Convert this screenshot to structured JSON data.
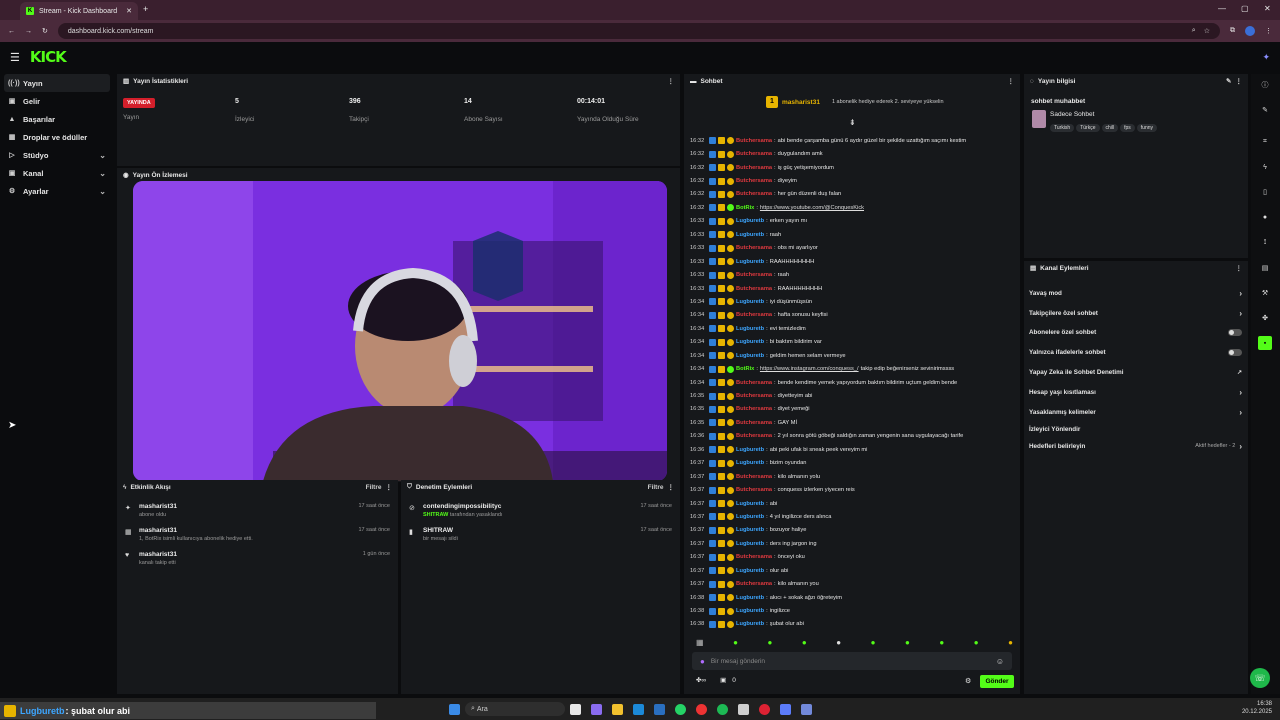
{
  "browser": {
    "tab_title": "Stream - Kick Dashboard",
    "url": "dashboard.kick.com/stream"
  },
  "app": {
    "logo": "KICK"
  },
  "sidebar": {
    "items": [
      {
        "label": "Yayın",
        "icon": "broadcast-icon",
        "active": true,
        "chevron": false
      },
      {
        "label": "Gelir",
        "icon": "wallet-icon",
        "active": false,
        "chevron": false
      },
      {
        "label": "Başarılar",
        "icon": "trophy-icon",
        "active": false,
        "chevron": false
      },
      {
        "label": "Droplar ve ödüller",
        "icon": "gift-icon",
        "active": false,
        "chevron": false
      },
      {
        "label": "Stüdyo",
        "icon": "studio-icon",
        "active": false,
        "chevron": true
      },
      {
        "label": "Kanal",
        "icon": "channel-icon",
        "active": false,
        "chevron": true
      },
      {
        "label": "Ayarlar",
        "icon": "gear-icon",
        "active": false,
        "chevron": true
      }
    ]
  },
  "stats": {
    "title": "Yayın İstatistikleri",
    "live_badge": "YAYINDA",
    "status_label": "Yayın",
    "items": [
      {
        "value": "5",
        "label": "İzleyici"
      },
      {
        "value": "396",
        "label": "Takipçi"
      },
      {
        "value": "14",
        "label": "Abone Sayısı"
      },
      {
        "value": "00:14:01",
        "label": "Yayında Olduğu Süre"
      }
    ]
  },
  "preview": {
    "title": "Yayın Ön İzlemesi"
  },
  "activity": {
    "title": "Etkinlik Akışı",
    "filter": "Filtre",
    "items": [
      {
        "icon": "star-icon",
        "name": "masharist31",
        "sub": "abone oldu",
        "time": "17 saat önce"
      },
      {
        "icon": "gift-icon",
        "name": "masharist31",
        "sub": "1, BotRix isimli kullanıcıya abonelik hediye etti.",
        "time": "17 saat önce"
      },
      {
        "icon": "heart-icon",
        "name": "masharist31",
        "sub": "kanalı takip etti",
        "time": "1 gün önce"
      }
    ]
  },
  "moderation": {
    "title": "Denetim Eylemleri",
    "filter": "Filtre",
    "items": [
      {
        "icon": "ban-icon",
        "name": "contendingimpossibilityc",
        "sub_user": "SHITRAW",
        "sub": "tarafından yasaklandı",
        "time": "17 saat önce"
      },
      {
        "icon": "trash-icon",
        "name": "SHITRAW",
        "sub_user": "",
        "sub": "bir mesajı sildi",
        "time": "17 saat önce"
      }
    ]
  },
  "chat": {
    "title": "Sohbet",
    "pinned_user": "masharist31",
    "pinned_count": "1",
    "hype": "1 abonelik hediye ederek 2. seviyeye yükselin",
    "input_placeholder": "Bir mesaj gönderin",
    "send": "Gönder",
    "viewer_count": "0",
    "colors": {
      "red": "#e0393f",
      "blue": "#3da6ff",
      "green": "#53fc18"
    },
    "messages": [
      {
        "t": "16:32",
        "u": "Butchersama",
        "c": "red",
        "m": "abi bende çarşamba günü 6 aydır güzel bir şekilde uzattığım saçımı kestim"
      },
      {
        "t": "16:32",
        "u": "Butchersama",
        "c": "red",
        "m": "duygulandım amk"
      },
      {
        "t": "16:32",
        "u": "Butchersama",
        "c": "red",
        "m": "iş güç yetişemiyordum"
      },
      {
        "t": "16:32",
        "u": "Butchersama",
        "c": "red",
        "m": "diyeyim"
      },
      {
        "t": "16:32",
        "u": "Butchersama",
        "c": "red",
        "m": "her gün düzenli duş falan"
      },
      {
        "t": "16:32",
        "u": "BotRix",
        "c": "green",
        "m": "https://www.youtube.com/@ConquesKick",
        "link": true
      },
      {
        "t": "16:33",
        "u": "Lugburetb",
        "c": "blue",
        "m": "erken yayın mı"
      },
      {
        "t": "16:33",
        "u": "Lugburetb",
        "c": "blue",
        "m": "raah"
      },
      {
        "t": "16:33",
        "u": "Butchersama",
        "c": "red",
        "m": "obs mi ayarlıyor"
      },
      {
        "t": "16:33",
        "u": "Lugburetb",
        "c": "blue",
        "m": "RAAHHHHHHHH"
      },
      {
        "t": "16:33",
        "u": "Butchersama",
        "c": "red",
        "m": "raah"
      },
      {
        "t": "16:33",
        "u": "Butchersama",
        "c": "red",
        "m": "RAAHHHHHHHH"
      },
      {
        "t": "16:34",
        "u": "Lugburetb",
        "c": "blue",
        "m": "iyi düşünmüşsün"
      },
      {
        "t": "16:34",
        "u": "Butchersama",
        "c": "red",
        "m": "hafta sonusu keyfisi"
      },
      {
        "t": "16:34",
        "u": "Lugburetb",
        "c": "blue",
        "m": "evi temizledim"
      },
      {
        "t": "16:34",
        "u": "Lugburetb",
        "c": "blue",
        "m": "bi baktım bildirim var"
      },
      {
        "t": "16:34",
        "u": "Lugburetb",
        "c": "blue",
        "m": "geldim hemen selam vermeye"
      },
      {
        "t": "16:34",
        "u": "BotRix",
        "c": "green",
        "m": "https://www.instagram.com/conquess_/",
        "link": true,
        "extra": " takip edip beğenirseniz sevinirimssss"
      },
      {
        "t": "16:34",
        "u": "Butchersama",
        "c": "red",
        "m": "bende kendime yemek yapıyordum baktım bildirim uçtum geldim bende"
      },
      {
        "t": "16:35",
        "u": "Butchersama",
        "c": "red",
        "m": "diyetteyim abi"
      },
      {
        "t": "16:35",
        "u": "Butchersama",
        "c": "red",
        "m": "diyet yemeği"
      },
      {
        "t": "16:35",
        "u": "Butchersama",
        "c": "red",
        "m": "GAY Mİ"
      },
      {
        "t": "16:36",
        "u": "Butchersama",
        "c": "red",
        "m": "2 yıl sonra götü göbeği saldığın zaman yengenin sana uygulayacağı tarife"
      },
      {
        "t": "16:36",
        "u": "Lugburetb",
        "c": "blue",
        "m": "abi peki ufak bi sneak peek vereyim mi"
      },
      {
        "t": "16:37",
        "u": "Lugburetb",
        "c": "blue",
        "m": "bizim oyundan"
      },
      {
        "t": "16:37",
        "u": "Butchersama",
        "c": "red",
        "m": "kilo almanın yolu"
      },
      {
        "t": "16:37",
        "u": "Butchersama",
        "c": "red",
        "m": "conquess izlerken yiyecen reis"
      },
      {
        "t": "16:37",
        "u": "Lugburetb",
        "c": "blue",
        "m": "abi"
      },
      {
        "t": "16:37",
        "u": "Lugburetb",
        "c": "blue",
        "m": "4 yıl ingilizce ders alınca"
      },
      {
        "t": "16:37",
        "u": "Lugburetb",
        "c": "blue",
        "m": "bozuyor haliye"
      },
      {
        "t": "16:37",
        "u": "Lugburetb",
        "c": "blue",
        "m": "ders ing jargon ing"
      },
      {
        "t": "16:37",
        "u": "Butchersama",
        "c": "red",
        "m": "önceyi oku"
      },
      {
        "t": "16:37",
        "u": "Lugburetb",
        "c": "blue",
        "m": "olur abi"
      },
      {
        "t": "16:37",
        "u": "Butchersama",
        "c": "red",
        "m": "kilo almanın you"
      },
      {
        "t": "16:38",
        "u": "Lugburetb",
        "c": "blue",
        "m": "akıcı + sokak ağzı öğreteyim"
      },
      {
        "t": "16:38",
        "u": "Lugburetb",
        "c": "blue",
        "m": "ingilizce"
      },
      {
        "t": "16:38",
        "u": "Lugburetb",
        "c": "blue",
        "m": "şubat olur abi"
      }
    ]
  },
  "stream_info": {
    "title": "Yayın bilgisi",
    "stream_title": "sohbet muhabbet",
    "category": "Sadece Sohbet",
    "tags": [
      "Turkish",
      "Türkçe",
      "chill",
      "fps",
      "funny"
    ]
  },
  "channel_actions": {
    "title": "Kanal Eylemleri",
    "items": [
      {
        "label": "Yavaş mod",
        "ctl": "chevron"
      },
      {
        "label": "Takipçilere özel sohbet",
        "ctl": "chevron"
      },
      {
        "label": "Abonelere özel sohbet",
        "ctl": "toggle"
      },
      {
        "label": "Yalnızca ifadelerle sohbet",
        "ctl": "toggle"
      },
      {
        "label": "Yapay Zeka ile Sohbet Denetimi",
        "ctl": "external"
      },
      {
        "label": "Hesap yaşı kısıtlaması",
        "ctl": "chevron"
      },
      {
        "label": "Yasaklanmış kelimeler",
        "ctl": "chevron"
      },
      {
        "label": "İzleyici Yönlendir",
        "ctl": "none"
      },
      {
        "label": "Hedefleri belirleyin",
        "ctl": "chevron",
        "badge": "Aktif hedefler - 2"
      }
    ]
  },
  "overlay_caption": {
    "user": "Lugburetb",
    "text": ": şubat olur abi"
  },
  "taskbar": {
    "search": "Ara",
    "time": "16:38",
    "date": "20.12.2025"
  }
}
